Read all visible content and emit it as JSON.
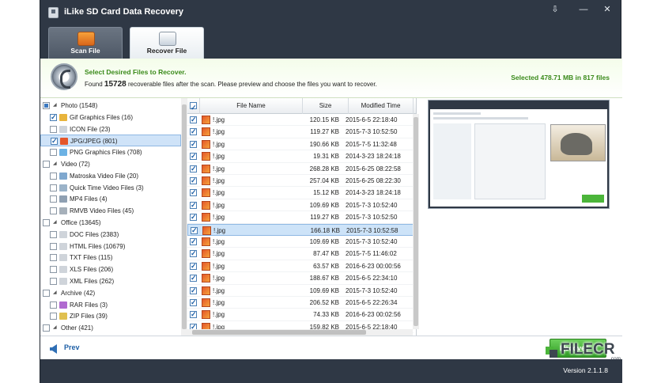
{
  "app": {
    "title": "iLike SD Card Data Recovery",
    "version": "Version 2.1.1.8"
  },
  "window_buttons": {
    "save": "⇩",
    "minimize": "—",
    "close": "✕"
  },
  "tabs": [
    {
      "label": "Scan File",
      "active": false
    },
    {
      "label": "Recover File",
      "active": true
    }
  ],
  "banner": {
    "title": "Select Desired Files to Recover.",
    "found_prefix": "Found",
    "found_count": "15728",
    "found_suffix": "recoverable files after the scan. Please preview and choose the files you want to recover.",
    "selected": "Selected 478.71 MB in 817 files"
  },
  "tree": [
    {
      "label": "Photo (1548)",
      "level": 0,
      "check": "partial",
      "expanded": true
    },
    {
      "label": "Gif Graphics Files (16)",
      "level": 1,
      "check": "checked",
      "icon_color": "#e8b43c"
    },
    {
      "label": "ICON File (23)",
      "level": 1,
      "check": "none",
      "icon_color": "#cfd4da"
    },
    {
      "label": "JPG/JPEG (801)",
      "level": 1,
      "check": "checked",
      "icon_color": "#e4562a",
      "selected": true
    },
    {
      "label": "PNG Graphics Files (708)",
      "level": 1,
      "check": "none",
      "icon_color": "#6cb2e4"
    },
    {
      "label": "Video (72)",
      "level": 0,
      "check": "none",
      "expanded": true
    },
    {
      "label": "Matroska Video File (20)",
      "level": 1,
      "check": "none",
      "icon_color": "#7fa8cf"
    },
    {
      "label": "Quick Time Video Files (3)",
      "level": 1,
      "check": "none",
      "icon_color": "#9bb3c9"
    },
    {
      "label": "MP4 Files (4)",
      "level": 1,
      "check": "none",
      "icon_color": "#8fa0b2"
    },
    {
      "label": "RMVB Video Files (45)",
      "level": 1,
      "check": "none",
      "icon_color": "#a6b0ba"
    },
    {
      "label": "Office (13645)",
      "level": 0,
      "check": "none",
      "expanded": true
    },
    {
      "label": "DOC Files (2383)",
      "level": 1,
      "check": "none",
      "icon_color": "#cfd4da"
    },
    {
      "label": "HTML Files (10679)",
      "level": 1,
      "check": "none",
      "icon_color": "#cfd4da"
    },
    {
      "label": "TXT Files (115)",
      "level": 1,
      "check": "none",
      "icon_color": "#cfd4da"
    },
    {
      "label": "XLS Files (206)",
      "level": 1,
      "check": "none",
      "icon_color": "#cfd4da"
    },
    {
      "label": "XML Files (262)",
      "level": 1,
      "check": "none",
      "icon_color": "#cfd4da"
    },
    {
      "label": "Archive (42)",
      "level": 0,
      "check": "none",
      "expanded": true
    },
    {
      "label": "RAR Files (3)",
      "level": 1,
      "check": "none",
      "icon_color": "#b06ad0"
    },
    {
      "label": "ZIP Files (39)",
      "level": 1,
      "check": "none",
      "icon_color": "#e0c050"
    },
    {
      "label": "Other (421)",
      "level": 0,
      "check": "none",
      "expanded": true
    }
  ],
  "filelist": {
    "headers": {
      "name": "File Name",
      "size": "Size",
      "modified": "Modified Time"
    },
    "rows": [
      {
        "name": "!.jpg",
        "size": "120.15 KB",
        "date": "2015-6-5 22:18:40",
        "selected": false
      },
      {
        "name": "!.jpg",
        "size": "119.27 KB",
        "date": "2015-7-3 10:52:50",
        "selected": false
      },
      {
        "name": "!.jpg",
        "size": "190.66 KB",
        "date": "2015-7-5 11:32:48",
        "selected": false
      },
      {
        "name": "!.jpg",
        "size": "19.31 KB",
        "date": "2014-3-23 18:24:18",
        "selected": false
      },
      {
        "name": "!.jpg",
        "size": "268.28 KB",
        "date": "2015-6-25 08:22:58",
        "selected": false
      },
      {
        "name": "!.jpg",
        "size": "257.04 KB",
        "date": "2015-6-25 08:22:30",
        "selected": false
      },
      {
        "name": "!.jpg",
        "size": "15.12 KB",
        "date": "2014-3-23 18:24:18",
        "selected": false
      },
      {
        "name": "!.jpg",
        "size": "109.69 KB",
        "date": "2015-7-3 10:52:40",
        "selected": false
      },
      {
        "name": "!.jpg",
        "size": "119.27 KB",
        "date": "2015-7-3 10:52:50",
        "selected": false
      },
      {
        "name": "!.jpg",
        "size": "166.18 KB",
        "date": "2015-7-3 10:52:58",
        "selected": true
      },
      {
        "name": "!.jpg",
        "size": "109.69 KB",
        "date": "2015-7-3 10:52:40",
        "selected": false
      },
      {
        "name": "!.jpg",
        "size": "87.47 KB",
        "date": "2015-7-5 11:46:02",
        "selected": false
      },
      {
        "name": "!.jpg",
        "size": "63.57 KB",
        "date": "2016-6-23 00:00:56",
        "selected": false
      },
      {
        "name": "!.jpg",
        "size": "188.67 KB",
        "date": "2015-6-5 22:34:10",
        "selected": false
      },
      {
        "name": "!.jpg",
        "size": "109.69 KB",
        "date": "2015-7-3 10:52:40",
        "selected": false
      },
      {
        "name": "!.jpg",
        "size": "206.52 KB",
        "date": "2015-6-5 22:26:34",
        "selected": false
      },
      {
        "name": "!.jpg",
        "size": "74.33 KB",
        "date": "2016-6-23 00:02:56",
        "selected": false
      },
      {
        "name": "!.jpg",
        "size": "159.82 KB",
        "date": "2015-6-5 22:18:40",
        "selected": false
      }
    ]
  },
  "bottom": {
    "prev": "Prev",
    "recover": "Recover"
  },
  "watermark": {
    "text": "FILECR",
    "sub": ".com"
  },
  "colors": {
    "accent_green": "#3a8a1a",
    "window_dark": "#2f3845",
    "selection_blue": "#cfe3f8"
  }
}
